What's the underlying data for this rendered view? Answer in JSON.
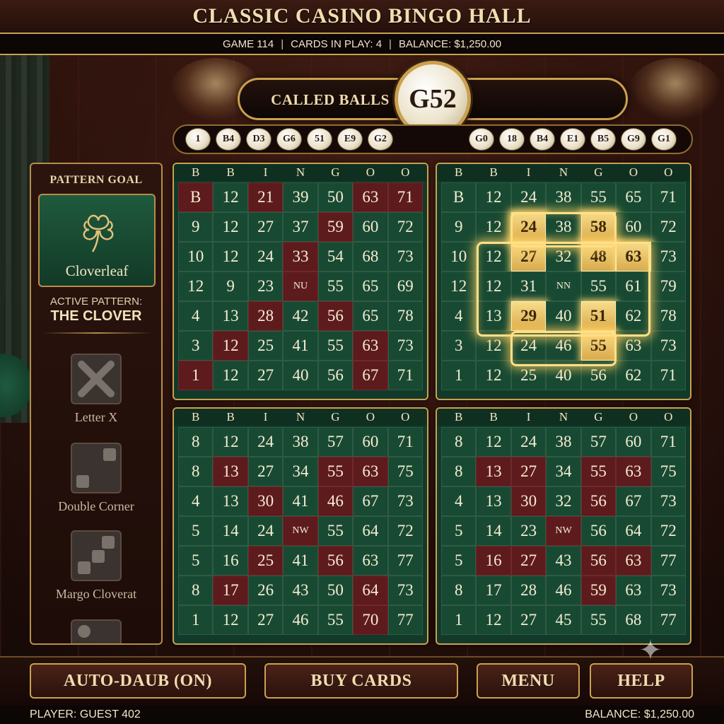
{
  "header": {
    "title": "CLASSIC CASINO BINGO HALL",
    "game": "GAME 114",
    "cards_in_play": "CARDS IN PLAY: 4",
    "balance": "BALANCE: $1,250.00",
    "sep": "|"
  },
  "called": {
    "label": "CALLED BALLS",
    "current": "G52",
    "history_left": [
      "1",
      "B4",
      "D3",
      "G6",
      "51",
      "E9",
      "G2"
    ],
    "history_right": [
      "G0",
      "18",
      "B4",
      "E1",
      "B5",
      "G9",
      "G1"
    ]
  },
  "sidebar": {
    "title": "PATTERN GOAL",
    "selected_pattern": "Cloverleaf",
    "active_label": "ACTIVE PATTERN:",
    "active_value": "THE CLOVER",
    "patterns": [
      "Letter X",
      "Double Corner",
      "Margo Cloverat"
    ]
  },
  "card_header": [
    "B",
    "B",
    "I",
    "N",
    "G",
    "O",
    "O"
  ],
  "cards": [
    {
      "rows": [
        [
          "B",
          "12",
          "21",
          "39",
          "50",
          "63",
          "71"
        ],
        [
          "9",
          "12",
          "27",
          "37",
          "59",
          "60",
          "72"
        ],
        [
          "10",
          "12",
          "24",
          "33",
          "54",
          "68",
          "73"
        ],
        [
          "12",
          "9",
          "23",
          "NU",
          "55",
          "65",
          "69"
        ],
        [
          "4",
          "13",
          "28",
          "42",
          "56",
          "65",
          "78"
        ],
        [
          "3",
          "12",
          "25",
          "41",
          "55",
          "63",
          "73"
        ],
        [
          "1",
          "12",
          "27",
          "40",
          "56",
          "67",
          "71"
        ]
      ]
    },
    {
      "rows": [
        [
          "B",
          "12",
          "24",
          "38",
          "55",
          "65",
          "71"
        ],
        [
          "9",
          "12",
          "24",
          "38",
          "58",
          "60",
          "72"
        ],
        [
          "10",
          "12",
          "27",
          "32",
          "48",
          "63",
          "73"
        ],
        [
          "12",
          "12",
          "31",
          "NN",
          "55",
          "61",
          "79"
        ],
        [
          "4",
          "13",
          "29",
          "40",
          "51",
          "62",
          "78"
        ],
        [
          "3",
          "12",
          "24",
          "46",
          "55",
          "63",
          "73"
        ],
        [
          "1",
          "12",
          "25",
          "40",
          "56",
          "62",
          "71"
        ]
      ]
    },
    {
      "rows": [
        [
          "8",
          "12",
          "24",
          "38",
          "57",
          "60",
          "71"
        ],
        [
          "8",
          "13",
          "27",
          "34",
          "55",
          "63",
          "75"
        ],
        [
          "4",
          "13",
          "30",
          "41",
          "46",
          "67",
          "73"
        ],
        [
          "5",
          "14",
          "24",
          "NW",
          "55",
          "64",
          "72"
        ],
        [
          "5",
          "16",
          "25",
          "41",
          "56",
          "63",
          "77"
        ],
        [
          "8",
          "17",
          "26",
          "43",
          "50",
          "64",
          "73"
        ],
        [
          "1",
          "12",
          "27",
          "46",
          "55",
          "70",
          "77"
        ]
      ]
    },
    {
      "rows": [
        [
          "8",
          "12",
          "24",
          "38",
          "57",
          "60",
          "71"
        ],
        [
          "8",
          "13",
          "27",
          "34",
          "55",
          "63",
          "75"
        ],
        [
          "4",
          "13",
          "30",
          "32",
          "56",
          "67",
          "73"
        ],
        [
          "5",
          "14",
          "23",
          "NW",
          "56",
          "64",
          "72"
        ],
        [
          "5",
          "16",
          "27",
          "43",
          "56",
          "63",
          "77"
        ],
        [
          "8",
          "17",
          "28",
          "46",
          "59",
          "63",
          "73"
        ],
        [
          "1",
          "12",
          "27",
          "45",
          "55",
          "68",
          "77"
        ]
      ]
    }
  ],
  "buttons": {
    "auto_daub": "AUTO-DAUB (ON)",
    "buy_cards": "BUY CARDS",
    "menu": "MENU",
    "help": "HELP"
  },
  "footer": {
    "player": "PLAYER: GUEST 402",
    "balance": "BALANCE: $1,250.00"
  }
}
